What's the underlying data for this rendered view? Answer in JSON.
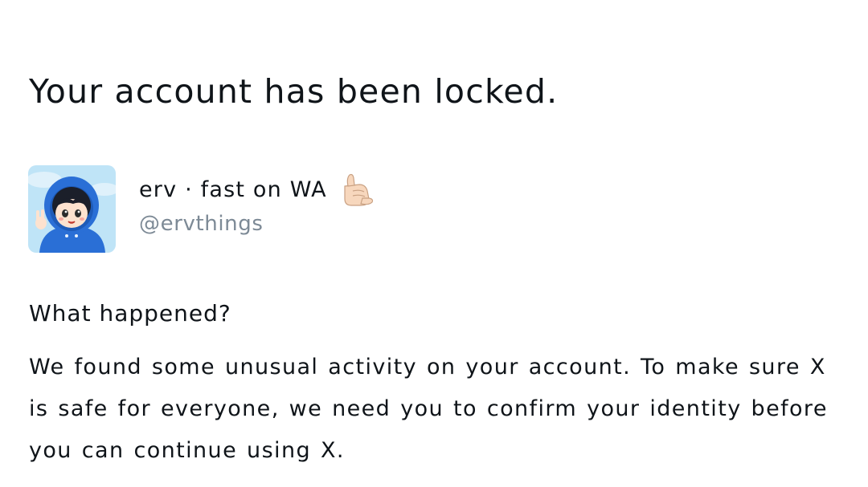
{
  "dialog": {
    "title": "Your account has been locked."
  },
  "user": {
    "display_name": "erv · fast on WA",
    "name_emoji_icon": "call-me-hand-icon",
    "handle": "@ervthings",
    "avatar_icon": "avatar-icon"
  },
  "details": {
    "heading": "What happened?",
    "body": "We found some unusual activity on your account. To make sure X is safe for everyone, we need you to confirm your identity before you can continue using X."
  },
  "colors": {
    "text": "#0f1419",
    "handle": "#7d8a96",
    "avatar_background": "#bfe4f7",
    "avatar_hoodie": "#2a6fd6"
  }
}
